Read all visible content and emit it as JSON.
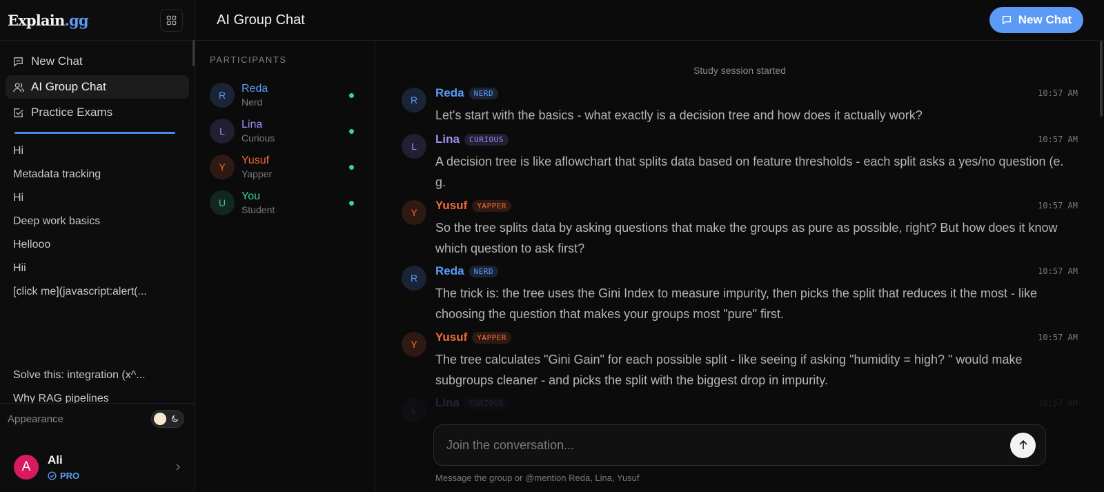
{
  "brand": {
    "name": "Explain",
    "suffix": ".gg"
  },
  "sidebar": {
    "nav": [
      {
        "label": "New Chat",
        "icon": "message-square-icon"
      },
      {
        "label": "AI Group Chat",
        "icon": "users-icon",
        "active": true
      },
      {
        "label": "Practice Exams",
        "icon": "checkbox-icon"
      }
    ],
    "history": [
      "Hi",
      "Metadata tracking",
      "Hi",
      "Deep work basics",
      "Hellooo",
      "Hii",
      "[click me](javascript:alert(..."
    ],
    "history_late": [
      "Solve this: integration (x^...",
      "Why RAG pipelines"
    ],
    "appearance_label": "Appearance",
    "user": {
      "initial": "A",
      "name": "Ali",
      "plan": "PRO"
    }
  },
  "header": {
    "title": "AI Group Chat",
    "new_chat_label": "New Chat"
  },
  "participants": {
    "heading": "PARTICIPANTS",
    "list": [
      {
        "initial": "R",
        "name": "Reda",
        "role": "Nerd",
        "color": "#5b9bf6",
        "bg": "#1b2436"
      },
      {
        "initial": "L",
        "name": "Lina",
        "role": "Curious",
        "color": "#a78bfa",
        "bg": "#231f33"
      },
      {
        "initial": "Y",
        "name": "Yusuf",
        "role": "Yapper",
        "color": "#f26b3a",
        "bg": "#2e1a12"
      },
      {
        "initial": "U",
        "name": "You",
        "role": "Student",
        "color": "#34d399",
        "bg": "#12271f"
      }
    ]
  },
  "chat": {
    "session_note": "Study session started",
    "messages": [
      {
        "initial": "R",
        "name": "Reda",
        "tag": "NERD",
        "time": "10:57 AM",
        "text": "Let's start with the basics - what exactly is a decision tree and how does it actually work?"
      },
      {
        "initial": "L",
        "name": "Lina",
        "tag": "CURIOUS",
        "time": "10:57 AM",
        "text": "A decision tree is like aflowchart that splits data based on feature thresholds - each split asks a yes/no question (e. g."
      },
      {
        "initial": "Y",
        "name": "Yusuf",
        "tag": "YAPPER",
        "time": "10:57 AM",
        "text": "So the tree splits data by asking questions that make the groups as pure as possible, right? But how does it know which question to ask first?"
      },
      {
        "initial": "R",
        "name": "Reda",
        "tag": "NERD",
        "time": "10:57 AM",
        "text": "The trick is: the tree uses the Gini Index to measure impurity, then picks the split that reduces it the most - like choosing the question that makes your groups most \"pure\" first."
      },
      {
        "initial": "Y",
        "name": "Yusuf",
        "tag": "YAPPER",
        "time": "10:57 AM",
        "text": "The tree calculates \"Gini Gain\" for each possible split - like seeing if asking \"humidity = high? \" would make subgroups cleaner - and picks the split with the biggest drop in impurity."
      },
      {
        "initial": "L",
        "name": "Lina",
        "tag": "CURIOUS",
        "time": "10:57 AM",
        "text": ""
      }
    ],
    "input_placeholder": "Join the conversation...",
    "hint": "Message the group or @mention Reda, Lina, Yusuf"
  },
  "colors": {
    "accent": "#5b9bf5",
    "online": "#34d399"
  }
}
